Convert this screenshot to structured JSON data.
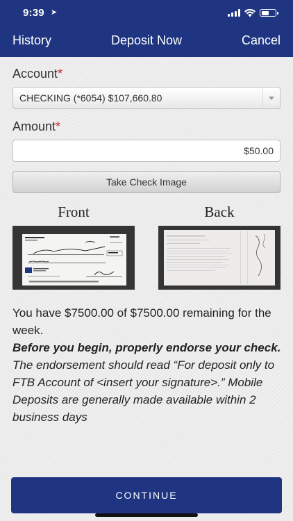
{
  "status": {
    "time": "9:39",
    "location_icon": "location-arrow-icon"
  },
  "nav": {
    "left": "History",
    "title": "Deposit Now",
    "right": "Cancel"
  },
  "form": {
    "account_label": "Account",
    "account_value": "CHECKING (*6054) $107,660.80",
    "amount_label": "Amount",
    "amount_value": "$50.00",
    "required_mark": "*",
    "take_image_label": "Take Check Image"
  },
  "images": {
    "front_label": "Front",
    "back_label": "Back"
  },
  "info": {
    "remaining": "You have $7500.00 of $7500.00 remaining for the week.",
    "endorse_bold": "Before you begin, properly endorse your check.",
    "endorse_rest": " The endorsement should read “For deposit only to FTB Account of <insert your signature>.” Mobile Deposits are generally made available within 2 business days"
  },
  "continue_label": "CONTINUE"
}
